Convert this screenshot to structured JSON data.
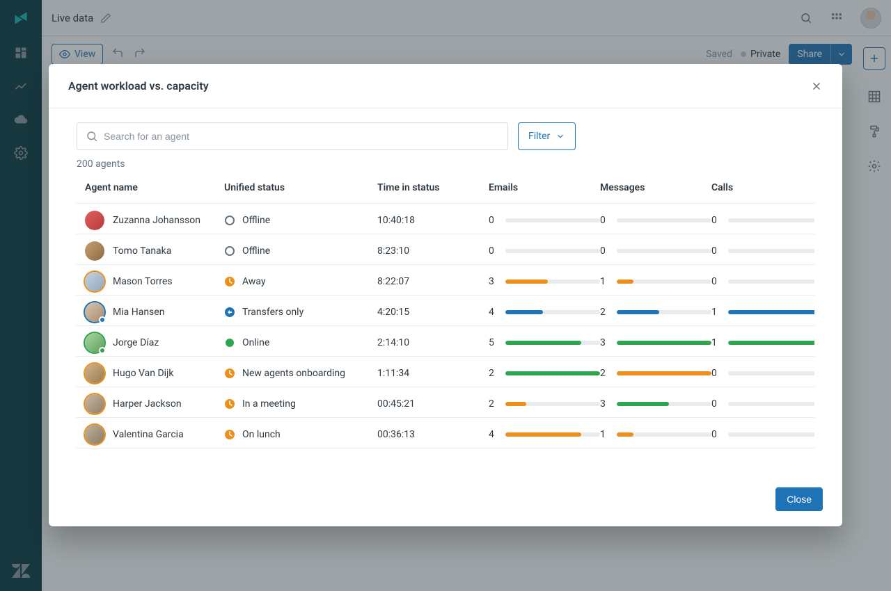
{
  "app": {
    "title": "Live data"
  },
  "toolbar": {
    "view_label": "View",
    "saved_label": "Saved",
    "private_label": "Private",
    "share_label": "Share"
  },
  "modal": {
    "title": "Agent workload vs. capacity",
    "search_placeholder": "Search for an agent",
    "filter_label": "Filter",
    "count_label": "200 agents",
    "close_label": "Close",
    "columns": {
      "agent": "Agent name",
      "status": "Unified status",
      "time": "Time in status",
      "emails": "Emails",
      "messages": "Messages",
      "calls": "Calls"
    },
    "rows": [
      {
        "name": "Zuzanna Johansson",
        "status": "Offline",
        "status_kind": "offline",
        "ring": "none",
        "badge": "",
        "avatar_color": "c0",
        "time": "10:40:18",
        "emails": {
          "v": 0,
          "p": 0,
          "c": "gray"
        },
        "messages": {
          "v": 0,
          "p": 0,
          "c": "gray"
        },
        "calls": {
          "v": 0,
          "p": 0,
          "c": "gray"
        }
      },
      {
        "name": "Tomo Tanaka",
        "status": "Offline",
        "status_kind": "offline",
        "ring": "none",
        "badge": "",
        "avatar_color": "c1",
        "time": "8:23:10",
        "emails": {
          "v": 0,
          "p": 0,
          "c": "gray"
        },
        "messages": {
          "v": 0,
          "p": 0,
          "c": "gray"
        },
        "calls": {
          "v": 0,
          "p": 0,
          "c": "gray"
        }
      },
      {
        "name": "Mason Torres",
        "status": "Away",
        "status_kind": "away",
        "ring": "orange",
        "badge": "",
        "avatar_color": "c2",
        "time": "8:22:07",
        "emails": {
          "v": 3,
          "p": 45,
          "c": "orange"
        },
        "messages": {
          "v": 1,
          "p": 18,
          "c": "orange"
        },
        "calls": {
          "v": 0,
          "p": 0,
          "c": "gray"
        }
      },
      {
        "name": "Mia Hansen",
        "status": "Transfers only",
        "status_kind": "transfer",
        "ring": "blue",
        "badge": "blue",
        "avatar_color": "c3",
        "time": "4:20:15",
        "emails": {
          "v": 4,
          "p": 40,
          "c": "blue"
        },
        "messages": {
          "v": 2,
          "p": 45,
          "c": "blue"
        },
        "calls": {
          "v": 1,
          "p": 100,
          "c": "blue"
        }
      },
      {
        "name": "Jorge Díaz",
        "status": "Online",
        "status_kind": "online",
        "ring": "green",
        "badge": "green",
        "avatar_color": "c4",
        "time": "2:14:10",
        "emails": {
          "v": 5,
          "p": 80,
          "c": "green"
        },
        "messages": {
          "v": 3,
          "p": 100,
          "c": "green"
        },
        "calls": {
          "v": 1,
          "p": 100,
          "c": "green"
        }
      },
      {
        "name": "Hugo Van Dijk",
        "status": "New agents onboarding",
        "status_kind": "away",
        "ring": "orange",
        "badge": "",
        "avatar_color": "c5",
        "time": "1:11:34",
        "emails": {
          "v": 2,
          "p": 100,
          "c": "green"
        },
        "messages": {
          "v": 2,
          "p": 100,
          "c": "orange"
        },
        "calls": {
          "v": 0,
          "p": 0,
          "c": "gray"
        }
      },
      {
        "name": "Harper Jackson",
        "status": "In a meeting",
        "status_kind": "away",
        "ring": "orange",
        "badge": "",
        "avatar_color": "c6",
        "time": "00:45:21",
        "emails": {
          "v": 2,
          "p": 22,
          "c": "orange"
        },
        "messages": {
          "v": 3,
          "p": 55,
          "c": "green"
        },
        "calls": {
          "v": 0,
          "p": 0,
          "c": "gray"
        }
      },
      {
        "name": "Valentina Garcia",
        "status": "On lunch",
        "status_kind": "away",
        "ring": "orange",
        "badge": "",
        "avatar_color": "c7",
        "time": "00:36:13",
        "emails": {
          "v": 4,
          "p": 80,
          "c": "orange"
        },
        "messages": {
          "v": 1,
          "p": 18,
          "c": "orange"
        },
        "calls": {
          "v": 0,
          "p": 0,
          "c": "gray"
        }
      }
    ]
  },
  "colors": {
    "gray": "#e9ebed",
    "orange": "#ed8f1c",
    "blue": "#1f73b7",
    "green": "#2ea44f"
  }
}
